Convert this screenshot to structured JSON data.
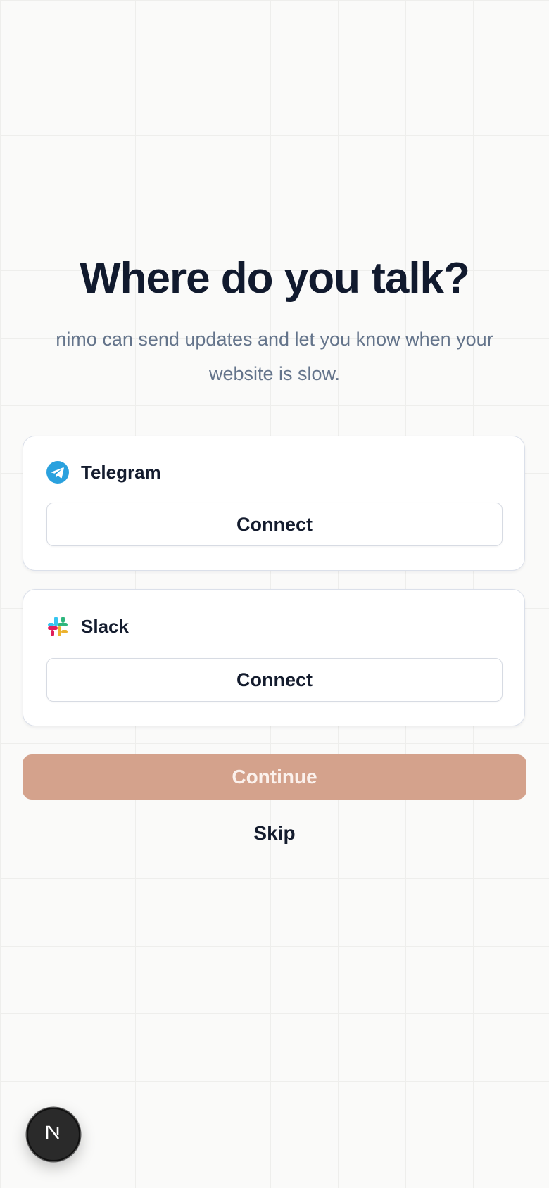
{
  "header": {
    "title": "Where do you talk?",
    "subtitle": "nimo can send updates and let you know when your website is slow."
  },
  "integrations": [
    {
      "name": "Telegram",
      "icon": "telegram-icon",
      "button_label": "Connect",
      "color": "#2aa1de"
    },
    {
      "name": "Slack",
      "icon": "slack-icon",
      "button_label": "Connect"
    }
  ],
  "actions": {
    "continue_label": "Continue",
    "skip_label": "Skip"
  },
  "dev_badge": {
    "icon": "nextjs-icon"
  },
  "colors": {
    "accent": "#d4a28c",
    "title": "#111a2e",
    "muted": "#64748b",
    "background": "#fafaf9"
  }
}
